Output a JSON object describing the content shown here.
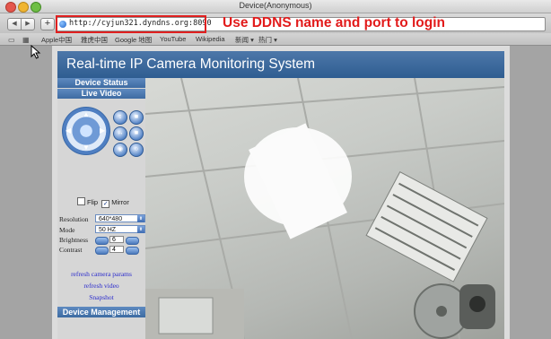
{
  "window": {
    "title": "Device(Anonymous)"
  },
  "toolbar": {
    "url": "http://cyjun321.dyndns.org:8090",
    "annotation": "Use DDNS name and port to login"
  },
  "bookmarks": [
    {
      "label": "Apple中国"
    },
    {
      "label": "雅虎中国"
    },
    {
      "label": "Google 地图"
    },
    {
      "label": "YouTube"
    },
    {
      "label": "Wikipedia"
    },
    {
      "label": "新闻 ▾"
    },
    {
      "label": "热门 ▾"
    }
  ],
  "app": {
    "title": "Real-time IP Camera Monitoring System",
    "sidebar": {
      "device_status": "Device Status",
      "live_video": "Live Video",
      "flip_label": "Flip",
      "mirror_label": "Mirror",
      "mirror_checked": true,
      "resolution_label": "Resolution",
      "resolution_value": "640*480",
      "mode_label": "Mode",
      "mode_value": "50 HZ",
      "brightness_label": "Brightness",
      "brightness_value": "6",
      "contrast_label": "Contrast",
      "contrast_value": "4",
      "refresh_params": "refresh camera params",
      "refresh_video": "refresh video",
      "snapshot": "Snapshot",
      "device_management": "Device Management"
    }
  }
}
